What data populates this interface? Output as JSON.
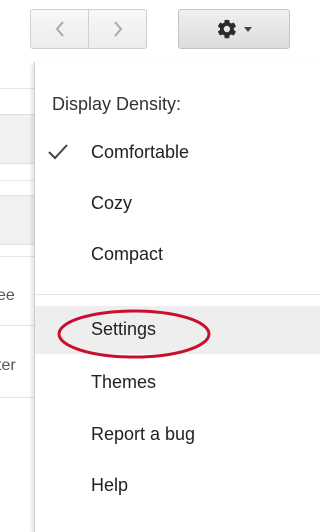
{
  "nav": {
    "prev_icon": "chevron-left-icon",
    "next_icon": "chevron-right-icon"
  },
  "settings_button": {
    "icon": "gear-icon",
    "caret_icon": "caret-down-icon"
  },
  "background": {
    "truncated_texts": [
      "ee",
      "ter"
    ]
  },
  "menu": {
    "heading": "Display Density:",
    "density_options": [
      {
        "label": "Comfortable",
        "checked": true
      },
      {
        "label": "Cozy",
        "checked": false
      },
      {
        "label": "Compact",
        "checked": false
      }
    ],
    "actions": [
      {
        "label": "Settings",
        "highlighted": true
      },
      {
        "label": "Themes"
      },
      {
        "label": "Report a bug"
      },
      {
        "label": "Help"
      }
    ]
  },
  "colors": {
    "annotation_circle": "#c8102e",
    "hover_bg": "#eeeeee"
  }
}
